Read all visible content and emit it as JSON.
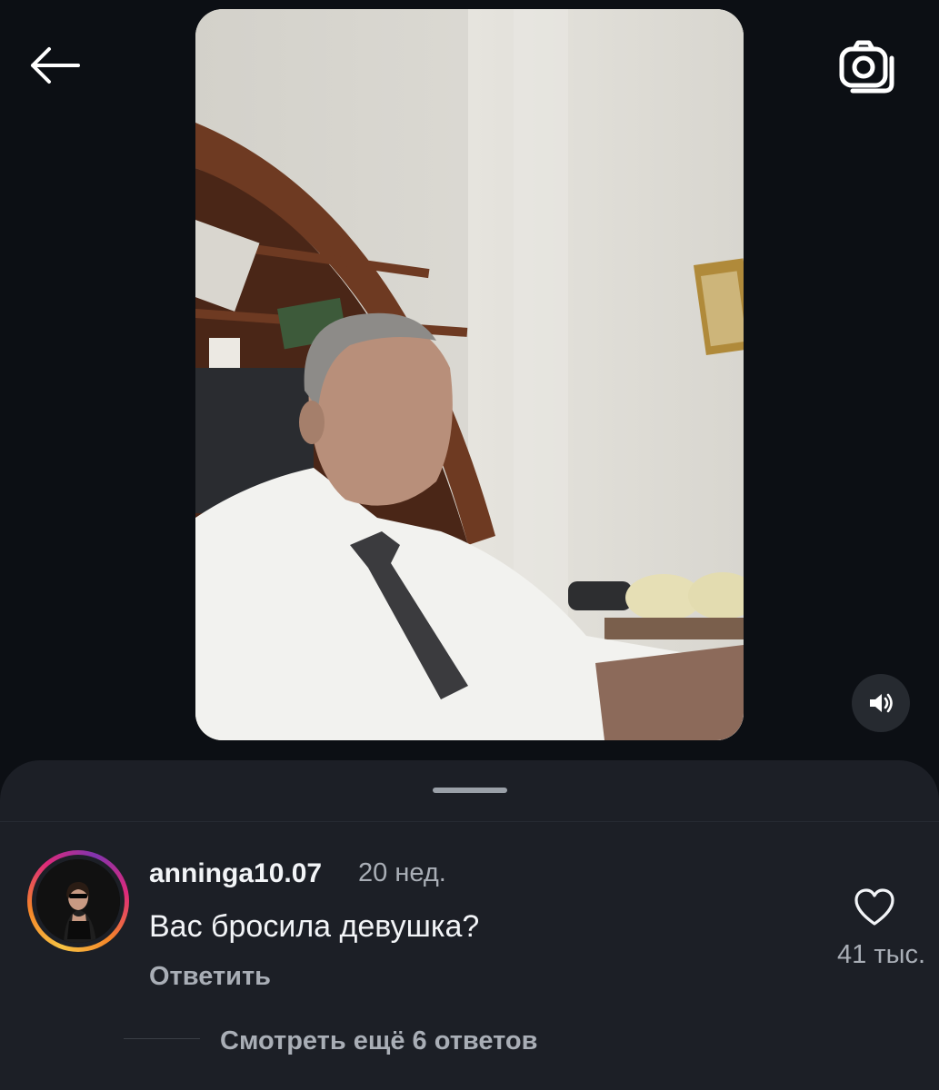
{
  "icons": {
    "back": "arrow-left-icon",
    "camera": "camera-icon",
    "sound": "speaker-icon",
    "like": "heart-icon"
  },
  "colors": {
    "background": "#0c0f14",
    "sheet": "#1c1f26",
    "text_primary": "#f2f4f7",
    "text_secondary": "#a9aeb6",
    "story_ring": [
      "#f6c343",
      "#f58529",
      "#dd2a7b",
      "#8134af"
    ]
  },
  "comment": {
    "username": "anninga10.07",
    "time": "20 нед.",
    "text": "Вас бросила девушка?",
    "reply_label": "Ответить",
    "likes": "41 тыс."
  },
  "replies": {
    "view_more_label": "Смотреть ещё 6 ответов"
  }
}
